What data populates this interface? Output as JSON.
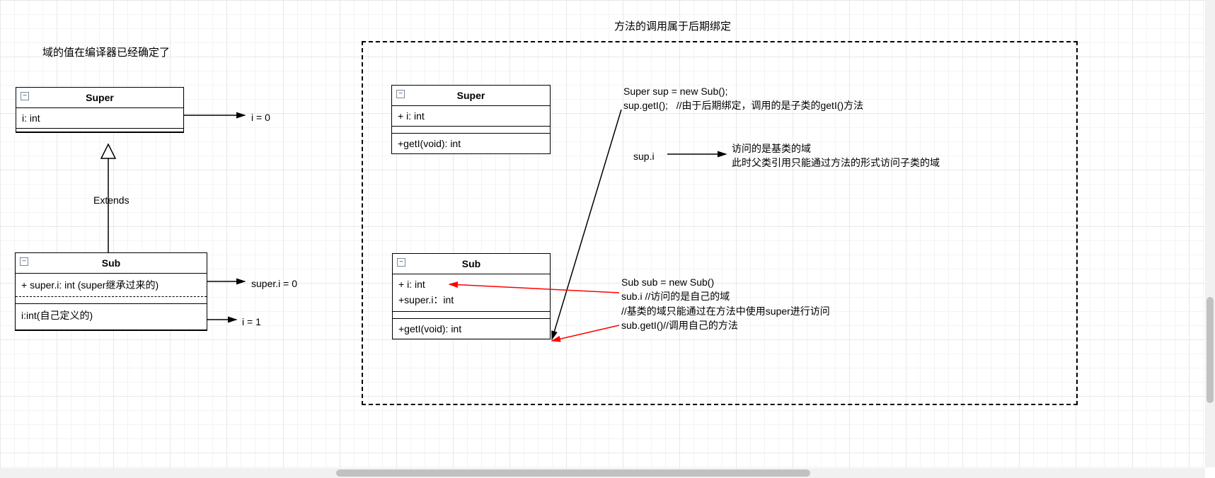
{
  "left": {
    "caption": "域的值在编译器已经确定了",
    "superClass": {
      "name": "Super",
      "field": "i: int",
      "arrowLabel": "i = 0"
    },
    "extendsLabel": "Extends",
    "subClass": {
      "name": "Sub",
      "field1": "+ super.i: int (super继承过来的)",
      "field2": "i:int(自己定义的)",
      "arrow1": "super.i = 0",
      "arrow2": "i = 1"
    }
  },
  "right": {
    "caption": "方法的调用属于后期绑定",
    "superClass": {
      "name": "Super",
      "field": "+ i: int",
      "method": "+getI(void): int"
    },
    "subClass": {
      "name": "Sub",
      "field1": "+ i: int",
      "field2": "+super.i：int",
      "method": "+getI(void): int"
    },
    "code1_line1": "Super sup = new Sub();",
    "code1_line2a": "sup.getI();",
    "code1_line2b": "//由于后期绑定，调用的是子类的getI()方法",
    "supI": "sup.i",
    "supI_note1": "访问的是基类的域",
    "supI_note2": "此时父类引用只能通过方法的形式访问子类的域",
    "code2_line1": "Sub sub = new Sub()",
    "code2_line2": "sub.i //访问的是自己的域",
    "code2_line3": "//基类的域只能通过在方法中使用super进行访问",
    "code2_line4": "sub.getI()//调用自己的方法"
  },
  "icons": {
    "collapse": "−"
  }
}
